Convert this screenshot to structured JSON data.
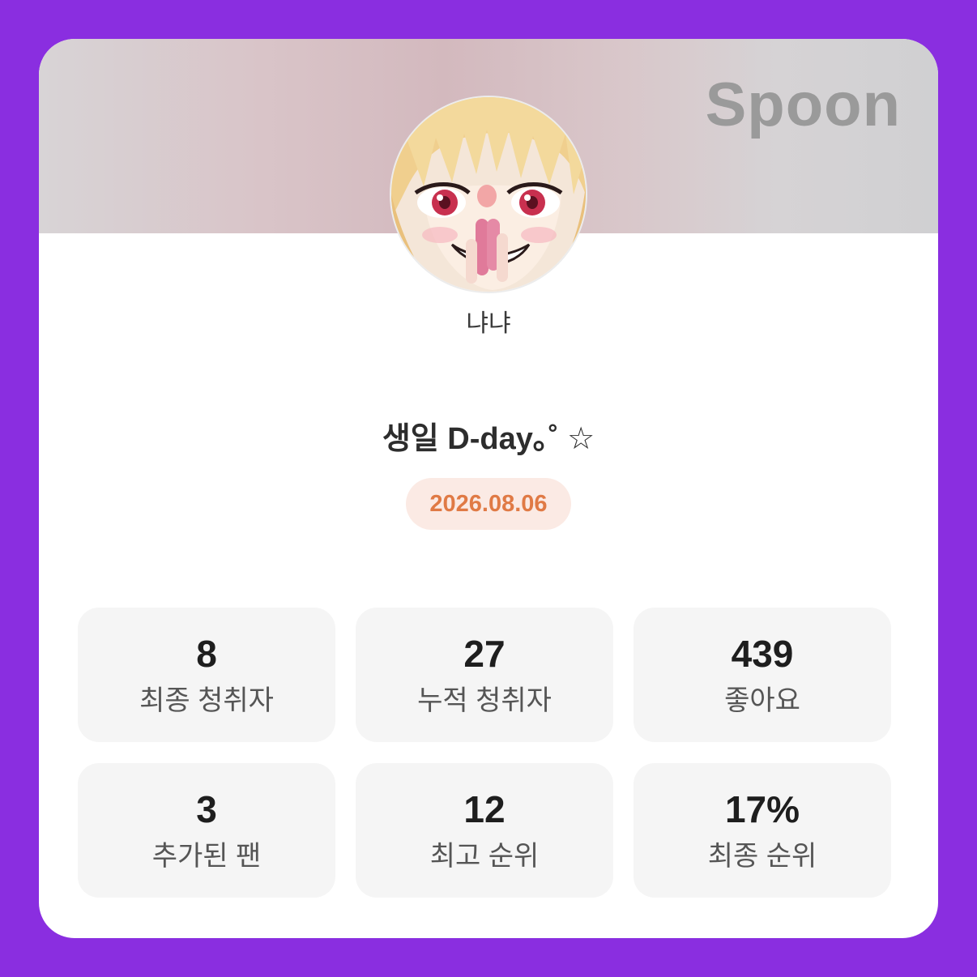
{
  "brand": "Spoon",
  "profile": {
    "nickname": "냐냐",
    "avatar_icon": "anime-avatar-icon"
  },
  "event": {
    "title": "생일 D-day｡˚ ☆",
    "date": "2026.08.06"
  },
  "stats": [
    {
      "value": "8",
      "label": "최종 청취자"
    },
    {
      "value": "27",
      "label": "누적 청취자"
    },
    {
      "value": "439",
      "label": "좋아요"
    },
    {
      "value": "3",
      "label": "추가된 팬"
    },
    {
      "value": "12",
      "label": "최고 순위"
    },
    {
      "value": "17%",
      "label": "최종 순위"
    }
  ],
  "colors": {
    "background": "#8a2ee0",
    "date_text": "#e07a45",
    "date_pill": "#fbeae4",
    "stat_tile": "#f5f5f5"
  }
}
